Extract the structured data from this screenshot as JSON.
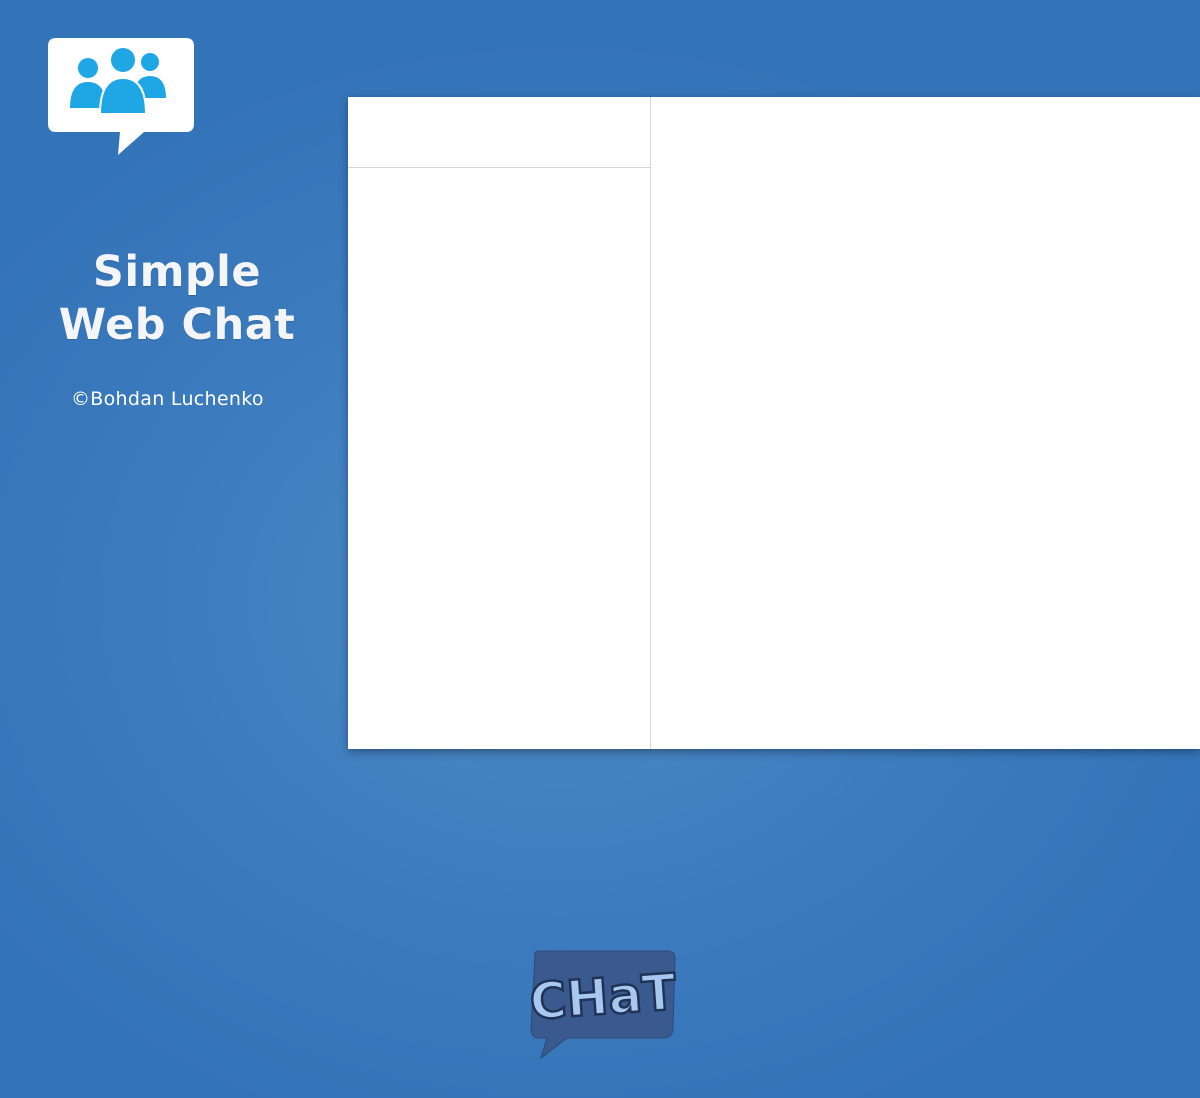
{
  "logo": {
    "icon": "users-chat-bubble-icon",
    "bubble_color": "#ffffff",
    "people_color": "#1ea7e4"
  },
  "brand": {
    "title_line1": "Simple",
    "title_line2": "Web Chat",
    "copyright": "©Bohdan Luchenko"
  },
  "chat_window": {
    "users_header": "",
    "users_list": [],
    "messages": []
  },
  "badge": {
    "icon": "chat-bubble-icon",
    "label": "CHaT",
    "bubble_color": "#3a598e",
    "text_color": "#a9c8ef"
  },
  "colors": {
    "background": "#3d7cbe",
    "panel": "#ffffff",
    "divider": "#d6d6d6"
  }
}
